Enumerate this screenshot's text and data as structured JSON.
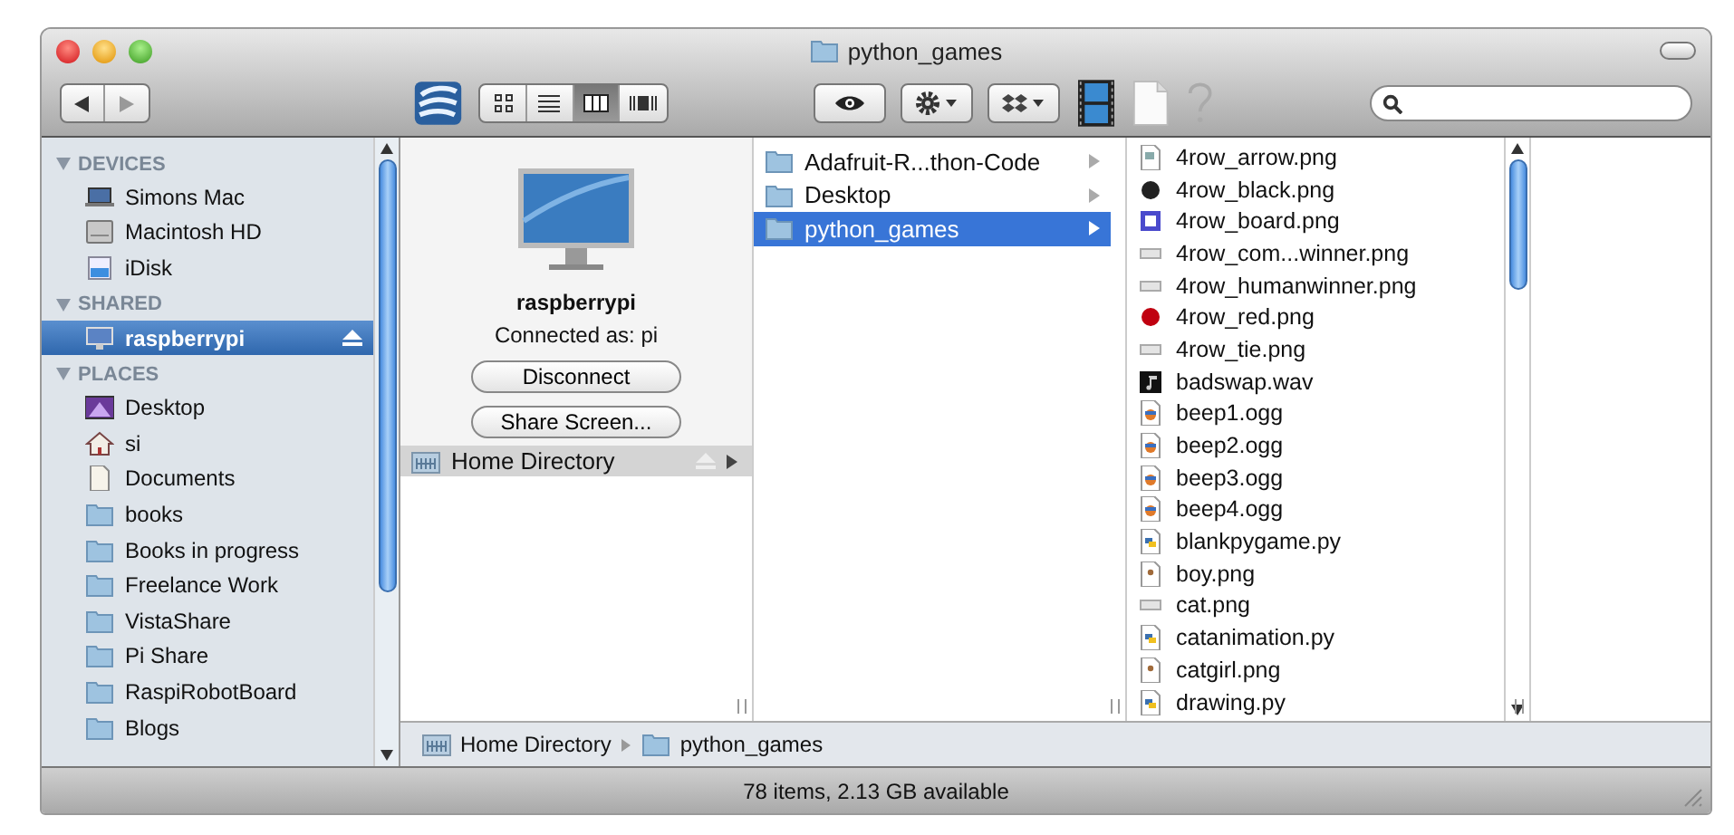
{
  "window": {
    "title": "python_games"
  },
  "toolbar": {
    "views": [
      {
        "kind": "icons",
        "selected": false
      },
      {
        "kind": "list",
        "selected": false
      },
      {
        "kind": "columns",
        "selected": true
      },
      {
        "kind": "coverflow",
        "selected": false
      }
    ]
  },
  "sidebar": {
    "sections": [
      {
        "title": "DEVICES",
        "expanded": true,
        "items": [
          {
            "label": "Simons Mac",
            "kind": "laptop",
            "selected": false,
            "eject": false
          },
          {
            "label": "Macintosh HD",
            "kind": "drive",
            "selected": false,
            "eject": false
          },
          {
            "label": "iDisk",
            "kind": "idisk",
            "selected": false,
            "eject": false
          }
        ]
      },
      {
        "title": "SHARED",
        "expanded": true,
        "items": [
          {
            "label": "raspberrypi",
            "kind": "monitor",
            "selected": true,
            "eject": true
          }
        ]
      },
      {
        "title": "PLACES",
        "expanded": true,
        "items": [
          {
            "label": "Desktop",
            "kind": "desktop",
            "selected": false,
            "eject": false
          },
          {
            "label": "si",
            "kind": "home",
            "selected": false,
            "eject": false
          },
          {
            "label": "Documents",
            "kind": "document",
            "selected": false,
            "eject": false
          },
          {
            "label": "books",
            "kind": "folder",
            "selected": false,
            "eject": false
          },
          {
            "label": "Books in progress",
            "kind": "folder",
            "selected": false,
            "eject": false
          },
          {
            "label": "Freelance Work",
            "kind": "folder",
            "selected": false,
            "eject": false
          },
          {
            "label": "VistaShare",
            "kind": "folder",
            "selected": false,
            "eject": false
          },
          {
            "label": "Pi Share",
            "kind": "folder",
            "selected": false,
            "eject": false
          },
          {
            "label": "RaspiRobotBoard",
            "kind": "folder",
            "selected": false,
            "eject": false
          },
          {
            "label": "Blogs",
            "kind": "folder",
            "selected": false,
            "eject": false
          }
        ]
      }
    ]
  },
  "server": {
    "name": "raspberrypi",
    "connected_as": "Connected as: pi",
    "buttons": [
      "Disconnect",
      "Share Screen..."
    ],
    "shares": [
      {
        "label": "Home Directory",
        "selected": true
      }
    ]
  },
  "folders": [
    {
      "label": "Adafruit-R...thon-Code",
      "selected": false
    },
    {
      "label": "Desktop",
      "selected": false
    },
    {
      "label": "python_games",
      "selected": true
    }
  ],
  "files": [
    {
      "label": "4row_arrow.png",
      "kind": "image"
    },
    {
      "label": "4row_black.png",
      "kind": "black-dot"
    },
    {
      "label": "4row_board.png",
      "kind": "square"
    },
    {
      "label": "4row_com...winner.png",
      "kind": "bar"
    },
    {
      "label": "4row_humanwinner.png",
      "kind": "bar"
    },
    {
      "label": "4row_red.png",
      "kind": "red-dot"
    },
    {
      "label": "4row_tie.png",
      "kind": "bar"
    },
    {
      "label": "badswap.wav",
      "kind": "music"
    },
    {
      "label": "beep1.ogg",
      "kind": "audio"
    },
    {
      "label": "beep2.ogg",
      "kind": "audio"
    },
    {
      "label": "beep3.ogg",
      "kind": "audio"
    },
    {
      "label": "beep4.ogg",
      "kind": "audio"
    },
    {
      "label": "blankpygame.py",
      "kind": "python"
    },
    {
      "label": "boy.png",
      "kind": "figure"
    },
    {
      "label": "cat.png",
      "kind": "bar"
    },
    {
      "label": "catanimation.py",
      "kind": "python"
    },
    {
      "label": "catgirl.png",
      "kind": "figure"
    },
    {
      "label": "drawing.py",
      "kind": "python"
    }
  ],
  "path_bar": [
    "Home Directory",
    "python_games"
  ],
  "status_bar": "78 items, 2.13 GB available"
}
